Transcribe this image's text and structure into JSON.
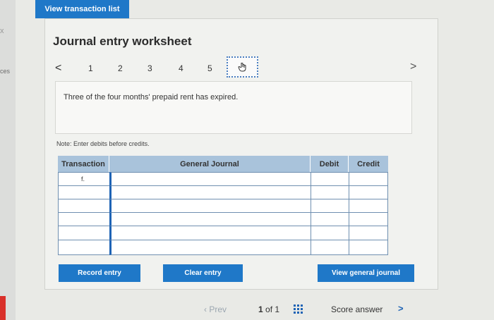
{
  "left_edge": {
    "text": "ces",
    "close_glyph": "x"
  },
  "top_button": {
    "label": "View transaction list"
  },
  "worksheet": {
    "title": "Journal entry worksheet",
    "nav": {
      "prev_glyph": "<",
      "next_glyph": ">",
      "numbers": [
        "1",
        "2",
        "3",
        "4",
        "5"
      ],
      "current_icon": "hand-pointer-icon"
    },
    "description": "Three of the four months' prepaid rent has expired.",
    "note": "Note: Enter debits before credits."
  },
  "journal_table": {
    "headers": [
      "Transaction",
      "General Journal",
      "Debit",
      "Credit"
    ],
    "rows": [
      {
        "transaction": "f.",
        "account": "",
        "debit": "",
        "credit": ""
      },
      {
        "transaction": "",
        "account": "",
        "debit": "",
        "credit": ""
      },
      {
        "transaction": "",
        "account": "",
        "debit": "",
        "credit": ""
      },
      {
        "transaction": "",
        "account": "",
        "debit": "",
        "credit": ""
      },
      {
        "transaction": "",
        "account": "",
        "debit": "",
        "credit": ""
      },
      {
        "transaction": "",
        "account": "",
        "debit": "",
        "credit": ""
      }
    ]
  },
  "actions": {
    "record": "Record entry",
    "clear": "Clear entry",
    "view_journal": "View general journal"
  },
  "footer": {
    "prev_label": "Prev",
    "page": "1",
    "of_label": "of 1",
    "score": "Score answer",
    "score_arrow": ">"
  },
  "colors": {
    "accent": "#1f78c8",
    "header": "#a9c3db",
    "selected_border": "#1e63b5"
  }
}
